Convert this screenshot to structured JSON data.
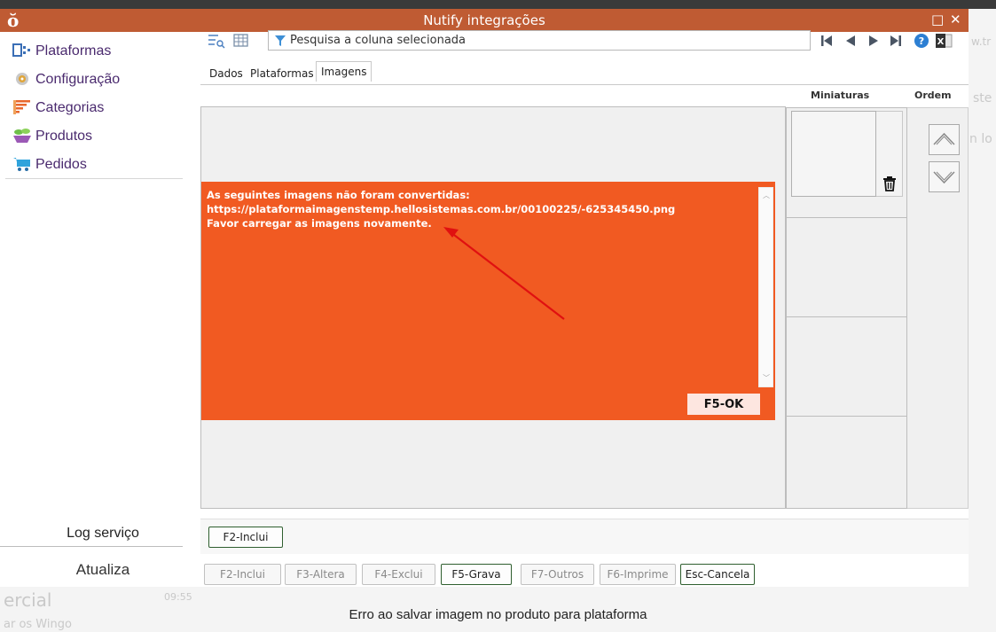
{
  "window": {
    "title": "Nutify integrações",
    "logo_glyph": "ŏ",
    "maximize_glyph": "□",
    "close_glyph": "✕"
  },
  "sidebar": {
    "items": [
      {
        "label": "Plataformas",
        "icon": "platforms-icon"
      },
      {
        "label": "Configuração",
        "icon": "settings-gear-icon"
      },
      {
        "label": "Categorias",
        "icon": "categories-list-icon"
      },
      {
        "label": "Produtos",
        "icon": "products-bowl-icon"
      },
      {
        "label": "Pedidos",
        "icon": "orders-cart-icon"
      }
    ],
    "log_label": "Log serviço",
    "update_label": "Atualiza"
  },
  "toolbar": {
    "search_placeholder": "Pesquisa a coluna selecionada",
    "nav": {
      "first": "⏮",
      "prev": "◀",
      "next": "▶",
      "last": "⏭"
    },
    "help_glyph": "?",
    "excel_glyph": "X"
  },
  "tabs": [
    {
      "label": "Dados"
    },
    {
      "label": "Plataformas"
    },
    {
      "label": "Imagens",
      "active": true
    }
  ],
  "images_panel": {
    "thumbnails_header": "Miniaturas",
    "order_header": "Ordem",
    "add_label": "F2-Inclui",
    "trash_glyph": "🗑"
  },
  "dialog": {
    "line1": "As seguintes imagens não foram convertidas:",
    "line2": "https://plataformaimagenstemp.hellosistemas.com.br/00100225/-625345450.png",
    "line3": "Favor carregar as imagens novamente.",
    "ok_label": "F5-OK",
    "scroll_up": "︿",
    "scroll_down": "﹀"
  },
  "bottom_buttons": [
    {
      "label": "F2-Inclui",
      "enabled": false
    },
    {
      "label": "F3-Altera",
      "enabled": false
    },
    {
      "label": "F4-Exclui",
      "enabled": false
    },
    {
      "label": "F5-Grava",
      "enabled": true
    },
    {
      "label": "F7-Outros",
      "enabled": false
    },
    {
      "label": "F6-Imprime",
      "enabled": false
    },
    {
      "label": "Esc-Cancela",
      "enabled": true
    }
  ],
  "status_message": "Erro ao salvar imagem no produto para plataforma",
  "background_ghost": {
    "left_text": "ercial",
    "left_sub": "ar os Wingo",
    "time": "09:55",
    "right_1": "w.tr",
    "right_2": "ste",
    "right_3": "n lo"
  }
}
